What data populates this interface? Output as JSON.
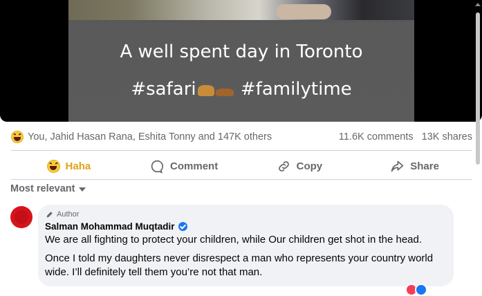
{
  "post_media": {
    "caption_line1": "A well spent day in Toronto",
    "caption_line2": "#safari",
    "caption_line2b": " #familytime"
  },
  "reactions": {
    "icon": "haha-emoji",
    "summary": "You, Jahid Hasan Rana, Eshita Tonny and 147K others",
    "comments": "11.6K comments",
    "shares": "13K shares"
  },
  "actions": {
    "react_label": "Haha",
    "comment_label": "Comment",
    "copy_label": "Copy",
    "share_label": "Share"
  },
  "comments_section": {
    "sort_label": "Most relevant",
    "top_comment": {
      "badge": "Author",
      "name": "Salman Mohammad Muqtadir",
      "text1": "We are all fighting to protect your children, while Our children get shot in the head.",
      "text2": "Once I told my daughters never disrespect a man who represents your country world wide. I’ll definitely tell them you’re not that man."
    }
  },
  "colors": {
    "haha_active": "#e0a416",
    "verified": "#1877f2",
    "avatar": "#d6141c",
    "muted_text": "#65676b"
  }
}
